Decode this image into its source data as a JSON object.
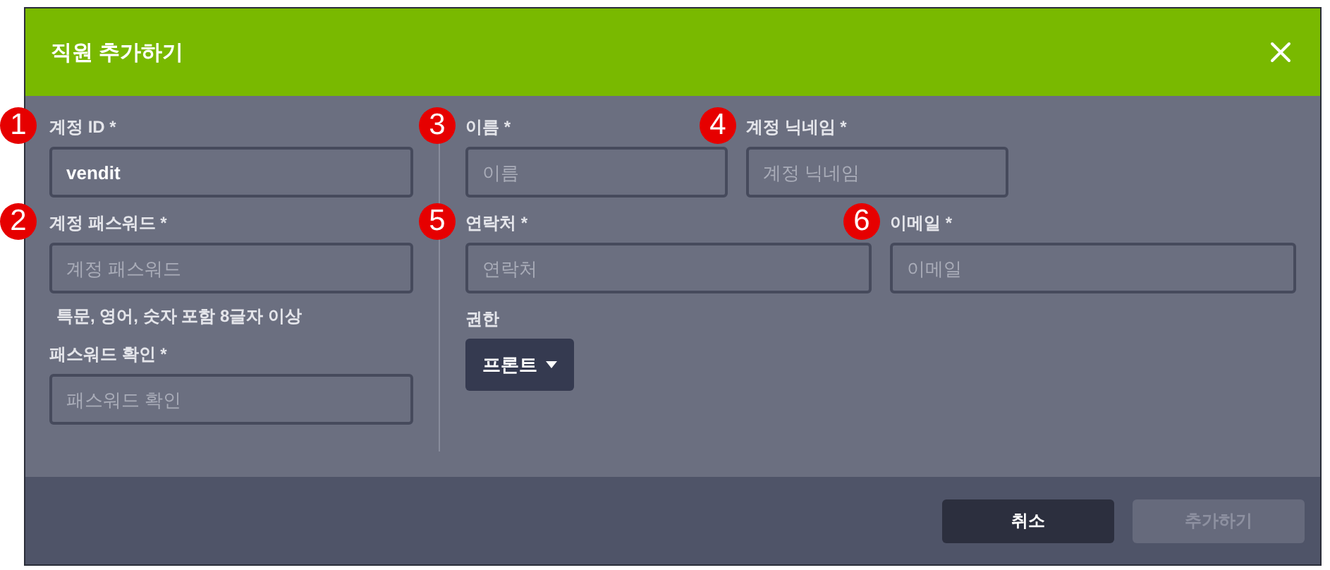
{
  "dialog": {
    "title": "직원 추가하기"
  },
  "left_fields": [
    {
      "label": "계정 ID *",
      "value": "vendit",
      "marker": "1"
    },
    {
      "label": "계정 패스워드 *",
      "placeholder": "계정 패스워드",
      "hint": "특문, 영어, 숫자 포함 8글자 이상",
      "marker": "2"
    },
    {
      "label": "패스워드 확인 *",
      "placeholder": "패스워드 확인"
    }
  ],
  "right_rows": [
    [
      {
        "label": "이름 *",
        "placeholder": "이름",
        "marker": "3"
      },
      {
        "label": "계정 닉네임 *",
        "placeholder": "계정 닉네임",
        "marker": "4"
      }
    ],
    [
      {
        "label": "연락처 *",
        "placeholder": "연락처",
        "marker": "5"
      },
      {
        "label": "이메일 *",
        "placeholder": "이메일",
        "marker": "6"
      }
    ]
  ],
  "role": {
    "label": "권한",
    "value": "프론트"
  },
  "buttons": [
    {
      "label": "취소",
      "disabled": false
    },
    {
      "label": "추가하기",
      "disabled": true
    }
  ]
}
